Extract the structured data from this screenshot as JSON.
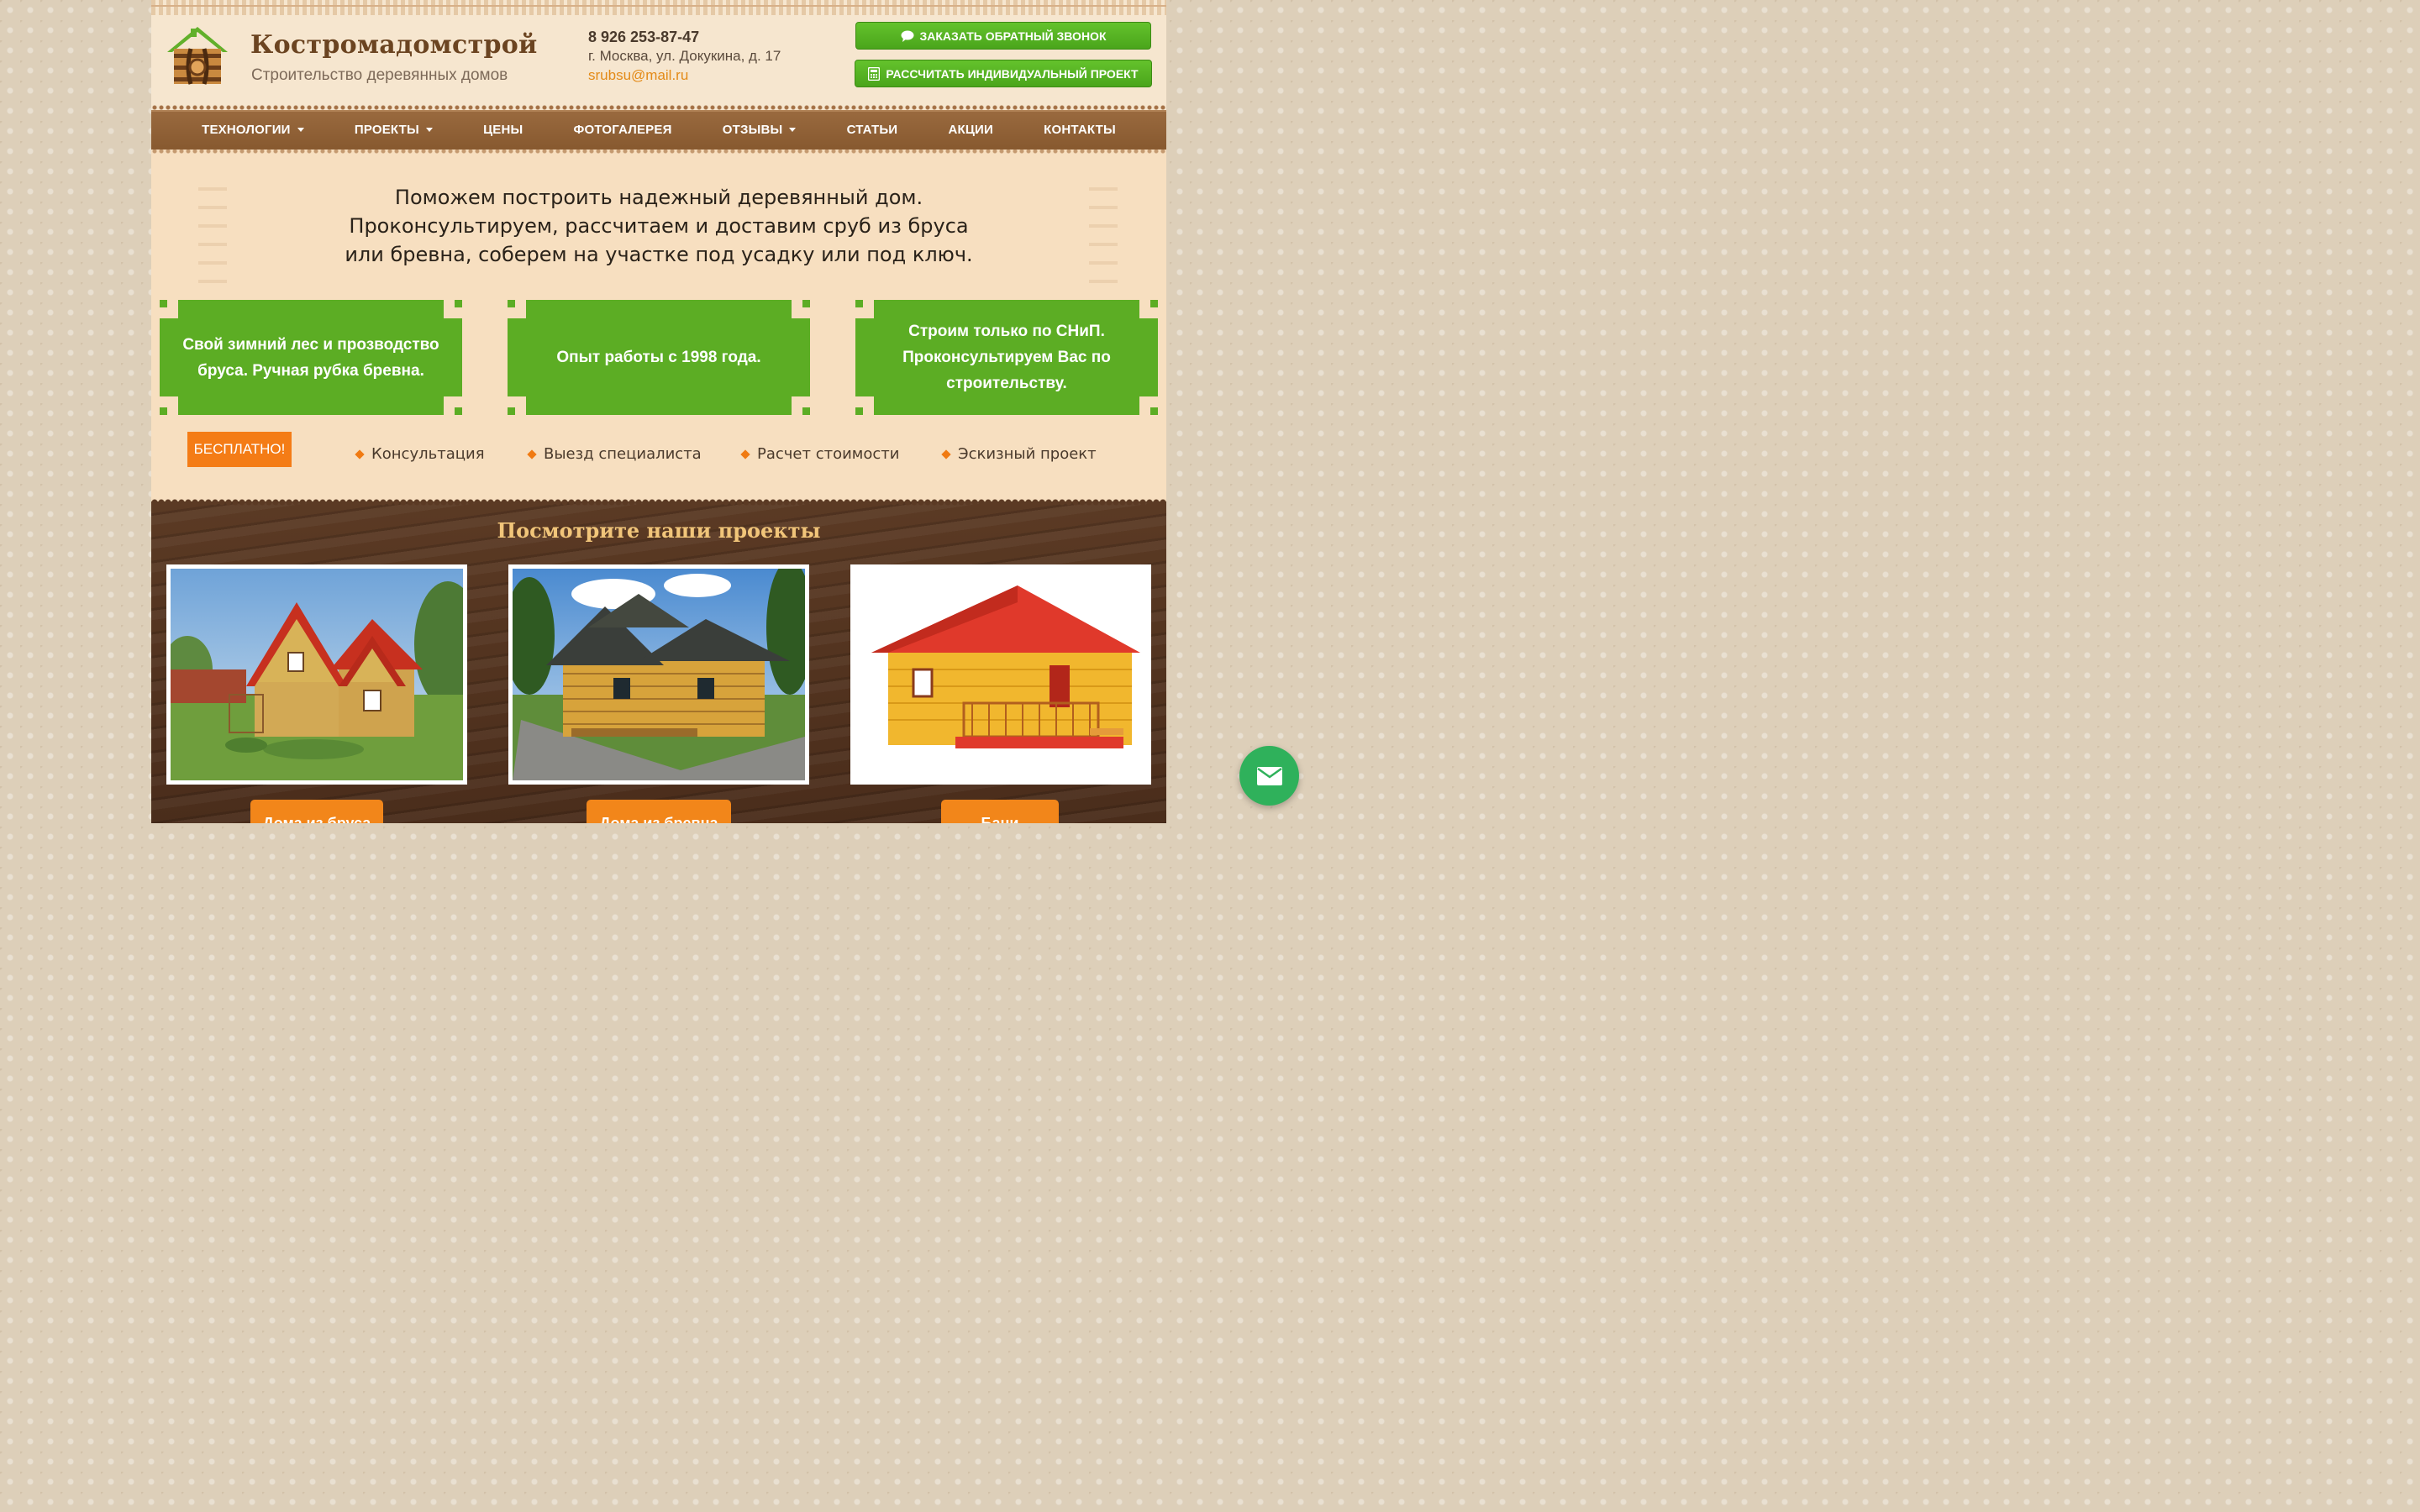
{
  "header": {
    "logo_name": "Костромадомстрой",
    "logo_tagline": "Строительство деревянных домов",
    "phone": "8 926 253-87-47",
    "address": "г. Москва, ул. Докукина, д. 17",
    "email": "srubsu@mail.ru",
    "callback_button": "ЗАКАЗАТЬ ОБРАТНЫЙ ЗВОНОК",
    "calc_button": "РАССЧИТАТЬ ИНДИВИДУАЛЬНЫЙ ПРОЕКТ",
    "callback_icon": "chat-bubble-icon",
    "calc_icon": "calculator-icon"
  },
  "nav": {
    "items": [
      {
        "label": "ТЕХНОЛОГИИ",
        "dropdown": true
      },
      {
        "label": "ПРОЕКТЫ",
        "dropdown": true
      },
      {
        "label": "ЦЕНЫ",
        "dropdown": false
      },
      {
        "label": "ФОТОГАЛЕРЕЯ",
        "dropdown": false
      },
      {
        "label": "ОТЗЫВЫ",
        "dropdown": true
      },
      {
        "label": "СТАТЬИ",
        "dropdown": false
      },
      {
        "label": "АКЦИИ",
        "dropdown": false
      },
      {
        "label": "КОНТАКТЫ",
        "dropdown": false
      }
    ]
  },
  "hero": {
    "lines": [
      "Поможем построить надежный деревянный дом.",
      "Проконсультируем, рассчитаем и доставим сруб из бруса",
      "или бревна, соберем на участке под усадку или под ключ."
    ]
  },
  "features": [
    {
      "lines": [
        "Свой зимний лес и прозводство",
        "бруса. Ручная рубка бревна."
      ]
    },
    {
      "lines": [
        "Опыт работы с 1998 года."
      ]
    },
    {
      "lines": [
        "Строим только по СНиП.",
        "Проконсультируем Вас по",
        "строительству."
      ]
    }
  ],
  "free": {
    "badge": "БЕСПЛАТНО!",
    "services": [
      "Консультация",
      "Выезд специалиста",
      "Расчет стоимости",
      "Эскизный проект"
    ]
  },
  "projects": {
    "title": "Посмотрите наши проекты",
    "cards": [
      {
        "button": "Дома из бруса"
      },
      {
        "button": "Дома из бревна"
      },
      {
        "button": "Бани"
      }
    ]
  },
  "colors": {
    "green": "#5cad24",
    "orange": "#f47c16",
    "nav_brown": "#8f6036",
    "wood_dark": "#4a2d1b",
    "title_gold": "#f1c57a",
    "fab_green": "#2fb15b"
  },
  "widget": {
    "icon": "mail-icon"
  }
}
